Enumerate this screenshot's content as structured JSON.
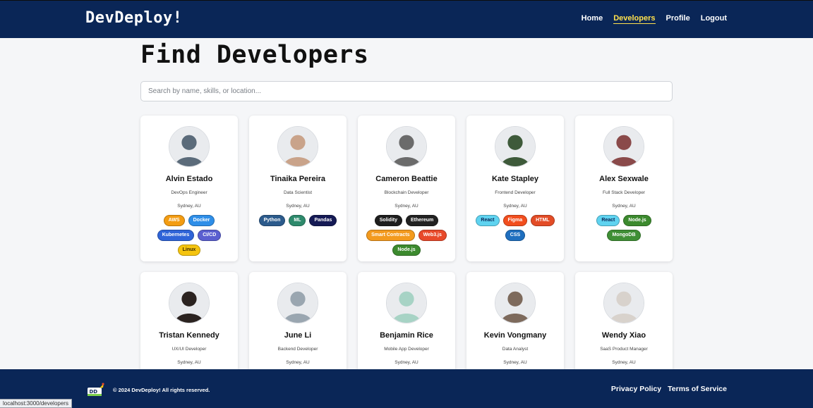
{
  "header": {
    "brand": "DevDeploy!",
    "nav": [
      {
        "label": "Home",
        "active": false
      },
      {
        "label": "Developers",
        "active": true
      },
      {
        "label": "Profile",
        "active": false
      },
      {
        "label": "Logout",
        "active": false
      }
    ]
  },
  "main": {
    "title": "Find Developers",
    "search_placeholder": "Search by name, skills, or location..."
  },
  "tag_colors": {
    "AWS": "#f39c12",
    "Docker": "#2e8ee8",
    "Kubernetes": "#2f64d8",
    "CI/CD": "#5a5fd0",
    "Linux": "#f5c40f",
    "Python": "#2c5b8c",
    "ML": "#2e8a6c",
    "Pandas": "#151a55",
    "Solidity": "#1e1e1e",
    "Ethereum": "#222222",
    "Smart Contracts": "#f39a1e",
    "Web3.js": "#e8492a",
    "Node.js": "#3c8a2e",
    "React": "#5fd3f0",
    "Figma": "#f24e1e",
    "HTML": "#e34c26",
    "CSS": "#1f6fbf",
    "MongoDB": "#3f8f35"
  },
  "developers": [
    {
      "name": "Alvin Estado",
      "role": "DevOps Engineer",
      "location": "Sydney, AU",
      "skills": [
        "AWS",
        "Docker",
        "Kubernetes",
        "CI/CD",
        "Linux"
      ],
      "avatar_color": "#5b6b7a"
    },
    {
      "name": "Tinaika Pereira",
      "role": "Data Scientist",
      "location": "Sydney, AU",
      "skills": [
        "Python",
        "ML",
        "Pandas"
      ],
      "avatar_color": "#c9a38a"
    },
    {
      "name": "Cameron Beattie",
      "role": "Blockchain Developer",
      "location": "Sydney, AU",
      "skills": [
        "Solidity",
        "Ethereum",
        "Smart Contracts",
        "Web3.js",
        "Node.js"
      ],
      "avatar_color": "#6b6b6b"
    },
    {
      "name": "Kate Stapley",
      "role": "Frontend Developer",
      "location": "Sydney, AU",
      "skills": [
        "React",
        "Figma",
        "HTML",
        "CSS"
      ],
      "avatar_color": "#3e5a3a"
    },
    {
      "name": "Alex Sexwale",
      "role": "Full Stack Developer",
      "location": "Sydney, AU",
      "skills": [
        "React",
        "Node.js",
        "MongoDB"
      ],
      "avatar_color": "#8a4a4a"
    },
    {
      "name": "Tristan Kennedy",
      "role": "UX/UI Developer",
      "location": "Sydney, AU",
      "skills": [],
      "avatar_color": "#2b2320"
    },
    {
      "name": "June Li",
      "role": "Backend Developer",
      "location": "Sydney, AU",
      "skills": [],
      "avatar_color": "#9aa6b0"
    },
    {
      "name": "Benjamin Rice",
      "role": "Mobile App Developer",
      "location": "Sydney, AU",
      "skills": [],
      "avatar_color": "#a7d3c5"
    },
    {
      "name": "Kevin Vongmany",
      "role": "Data Analyst",
      "location": "Sydney, AU",
      "skills": [],
      "avatar_color": "#7d6a5c"
    },
    {
      "name": "Wendy Xiao",
      "role": "SaaS Product Manager",
      "location": "Sydney, AU",
      "skills": [],
      "avatar_color": "#d8d2cc"
    }
  ],
  "footer": {
    "copyright": "© 2024 DevDeploy! All rights reserved.",
    "links": [
      "Privacy Policy",
      "Terms of Service"
    ]
  },
  "status_bar": {
    "url": "localhost:3000/developers"
  }
}
